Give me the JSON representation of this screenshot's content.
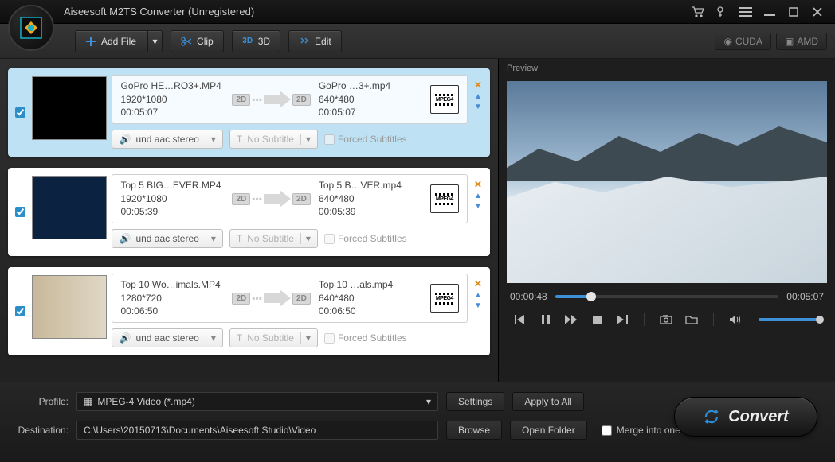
{
  "app": {
    "title": "Aiseesoft M2TS Converter (Unregistered)"
  },
  "toolbar": {
    "add_file": "Add File",
    "clip": "Clip",
    "three_d": "3D",
    "edit": "Edit",
    "cuda": "CUDA",
    "amd": "AMD"
  },
  "files": [
    {
      "selected": true,
      "in_name": "GoPro HE…RO3+.MP4",
      "in_res": "1920*1080",
      "in_dur": "00:05:07",
      "out_name": "GoPro …3+.mp4",
      "out_res": "640*480",
      "out_dur": "00:05:07",
      "audio": "und aac stereo",
      "subtitle": "No Subtitle",
      "forced_label": "Forced Subtitles",
      "format_label": "MPEG4"
    },
    {
      "selected": false,
      "in_name": "Top 5 BIG…EVER.MP4",
      "in_res": "1920*1080",
      "in_dur": "00:05:39",
      "out_name": "Top 5 B…VER.mp4",
      "out_res": "640*480",
      "out_dur": "00:05:39",
      "audio": "und aac stereo",
      "subtitle": "No Subtitle",
      "forced_label": "Forced Subtitles",
      "format_label": "MPEG4"
    },
    {
      "selected": false,
      "in_name": "Top 10 Wo…imals.MP4",
      "in_res": "1280*720",
      "in_dur": "00:06:50",
      "out_name": "Top 10 …als.mp4",
      "out_res": "640*480",
      "out_dur": "00:06:50",
      "audio": "und aac stereo",
      "subtitle": "No Subtitle",
      "forced_label": "Forced Subtitles",
      "format_label": "MPEG4"
    }
  ],
  "common": {
    "badge_2d": "2D"
  },
  "preview": {
    "label": "Preview",
    "current_time": "00:00:48",
    "total_time": "00:05:07"
  },
  "footer": {
    "profile_label": "Profile:",
    "profile_value": "MPEG-4 Video (*.mp4)",
    "settings": "Settings",
    "apply_all": "Apply to All",
    "dest_label": "Destination:",
    "dest_value": "C:\\Users\\20150713\\Documents\\Aiseesoft Studio\\Video",
    "browse": "Browse",
    "open_folder": "Open Folder",
    "merge": "Merge into one file",
    "convert": "Convert"
  }
}
